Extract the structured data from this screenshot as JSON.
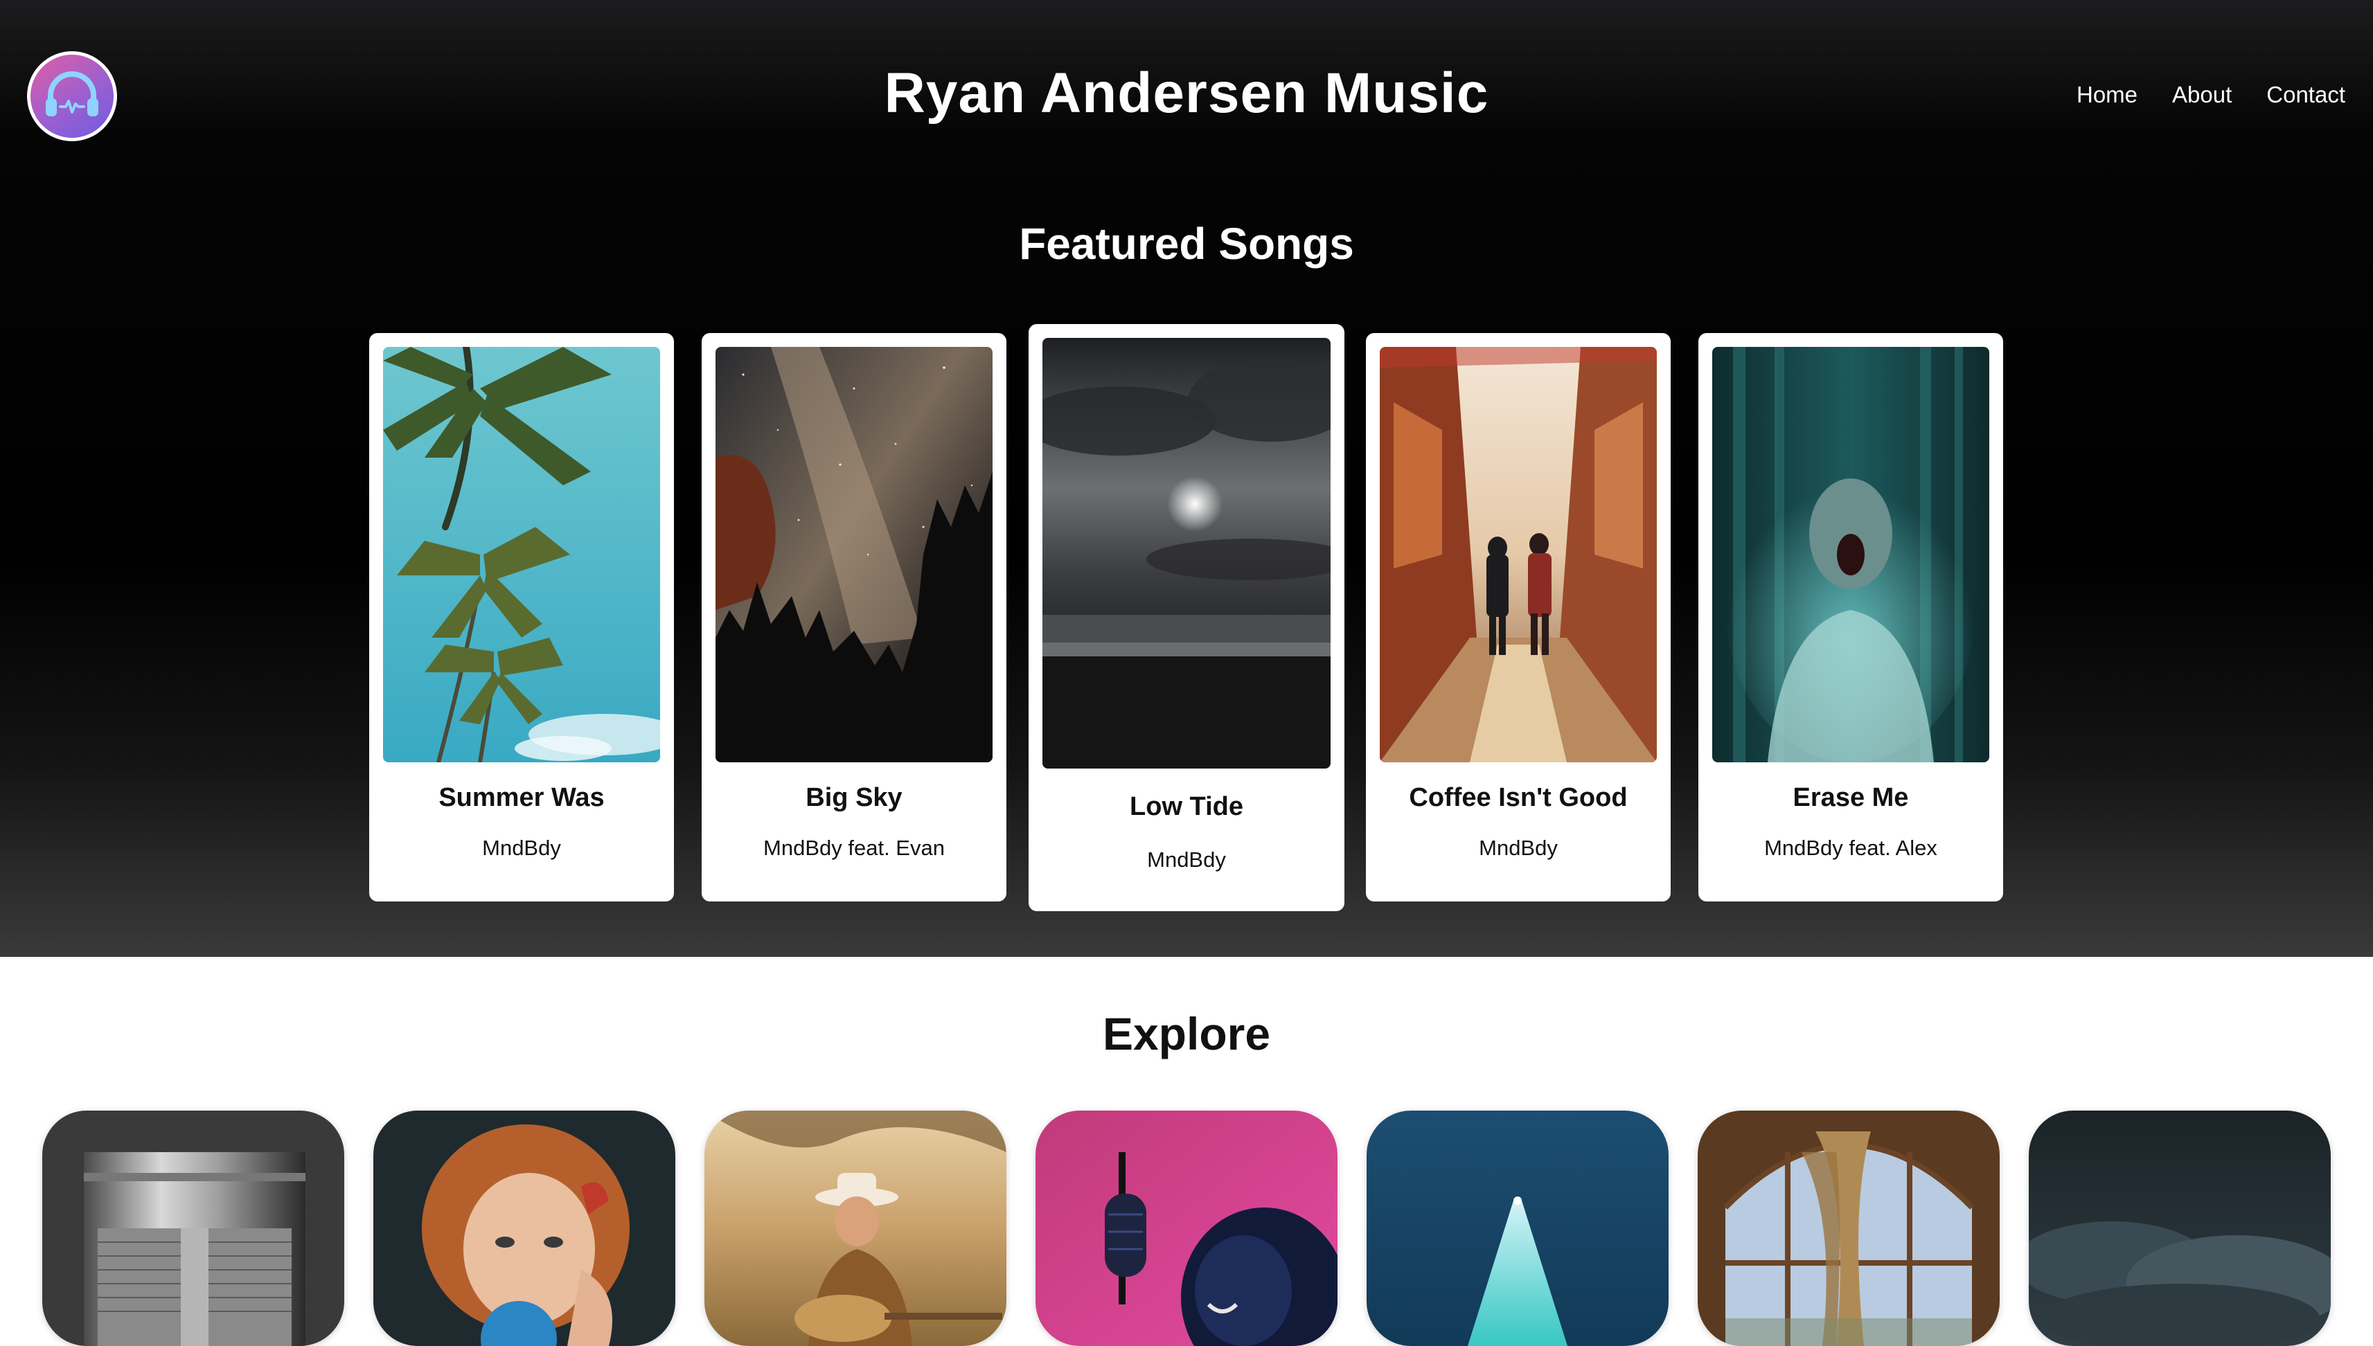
{
  "header": {
    "title": "Ryan Andersen Music",
    "logo_icon": "headphones-icon",
    "nav": [
      {
        "label": "Home"
      },
      {
        "label": "About"
      },
      {
        "label": "Contact"
      }
    ]
  },
  "featured": {
    "title": "Featured Songs",
    "songs": [
      {
        "title": "Summer Was",
        "artist": "MndBdy",
        "art": "palm-trees-image"
      },
      {
        "title": "Big Sky",
        "artist": "MndBdy feat. Evan",
        "art": "milky-way-forest-image"
      },
      {
        "title": "Low Tide",
        "artist": "MndBdy",
        "art": "stormy-beach-image"
      },
      {
        "title": "Coffee Isn't Good",
        "artist": "MndBdy",
        "art": "street-walkers-image"
      },
      {
        "title": "Erase Me",
        "artist": "MndBdy feat. Alex",
        "art": "blurred-screaming-man-image"
      }
    ]
  },
  "explore": {
    "title": "Explore",
    "tiles": [
      {
        "art": "microphone-closeup-image"
      },
      {
        "art": "woman-bubblegum-image"
      },
      {
        "art": "cowgirl-guitar-image"
      },
      {
        "art": "singer-microphone-image"
      },
      {
        "art": "spotlight-image"
      },
      {
        "art": "arched-window-curtains-image"
      },
      {
        "art": "dark-clouds-image"
      }
    ]
  },
  "colors": {
    "hero_background": "#000000",
    "card_background": "#ffffff",
    "logo_pink": "#e05fa4",
    "logo_purple": "#6e5ce0"
  }
}
